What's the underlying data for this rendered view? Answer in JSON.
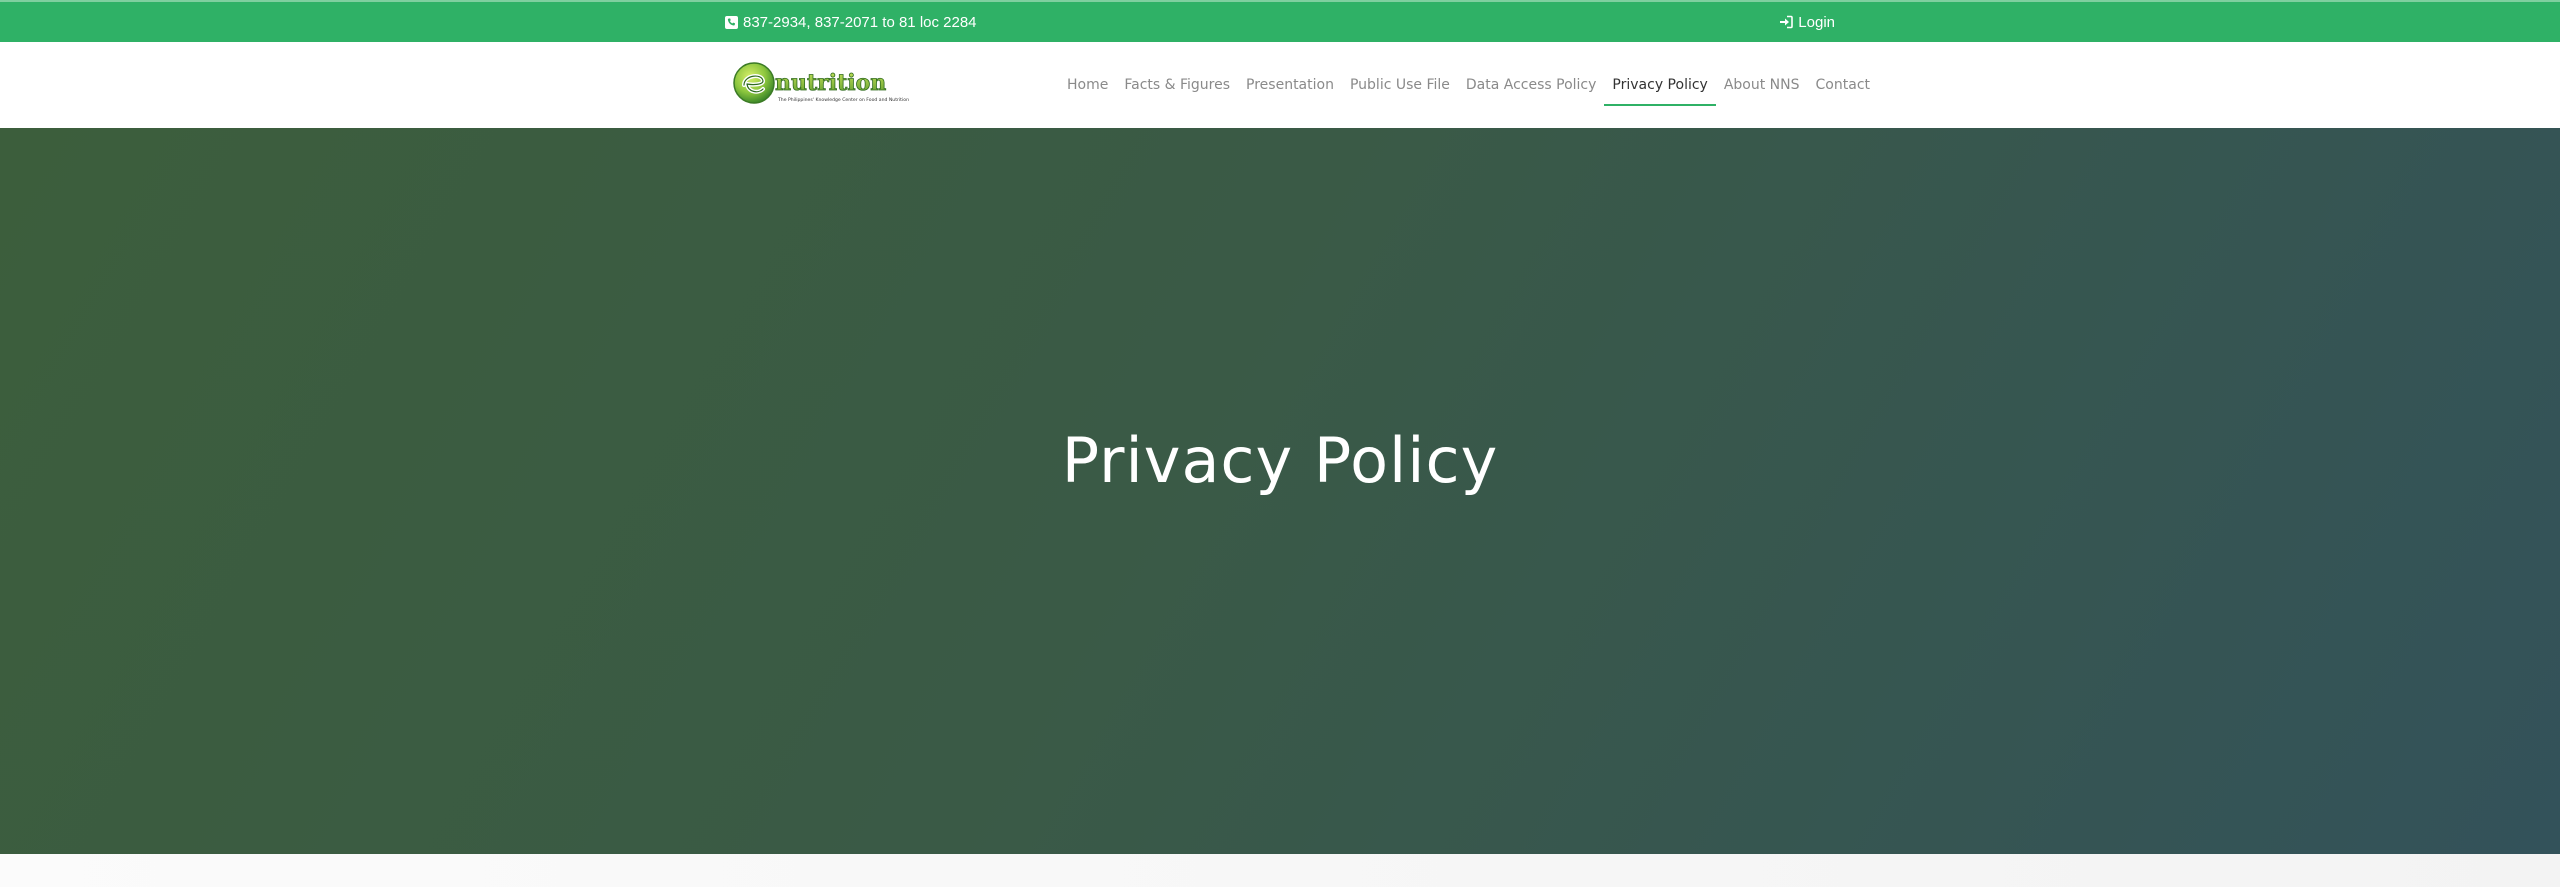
{
  "topbar": {
    "phone_text": "837-2934, 837-2071 to 81 loc 2284",
    "login_label": "Login"
  },
  "logo": {
    "brand": "nutrition",
    "tagline": "The Philippines' Knowledge Center on Food and Nutrition"
  },
  "nav": {
    "items": [
      {
        "label": "Home"
      },
      {
        "label": "Facts & Figures"
      },
      {
        "label": "Presentation"
      },
      {
        "label": "Public Use File"
      },
      {
        "label": "Data Access Policy"
      },
      {
        "label": "Privacy Policy"
      },
      {
        "label": "About NNS"
      },
      {
        "label": "Contact"
      }
    ],
    "active": "Privacy Policy"
  },
  "hero": {
    "title": "Privacy Policy"
  },
  "colors": {
    "topbar_bg": "#2fb166",
    "active_underline": "#2fb166",
    "hero_gradient_start": "#3c5e3c",
    "hero_gradient_end": "#33525a"
  },
  "icons": {
    "phone": "phone-square-icon",
    "login": "sign-in-icon"
  }
}
